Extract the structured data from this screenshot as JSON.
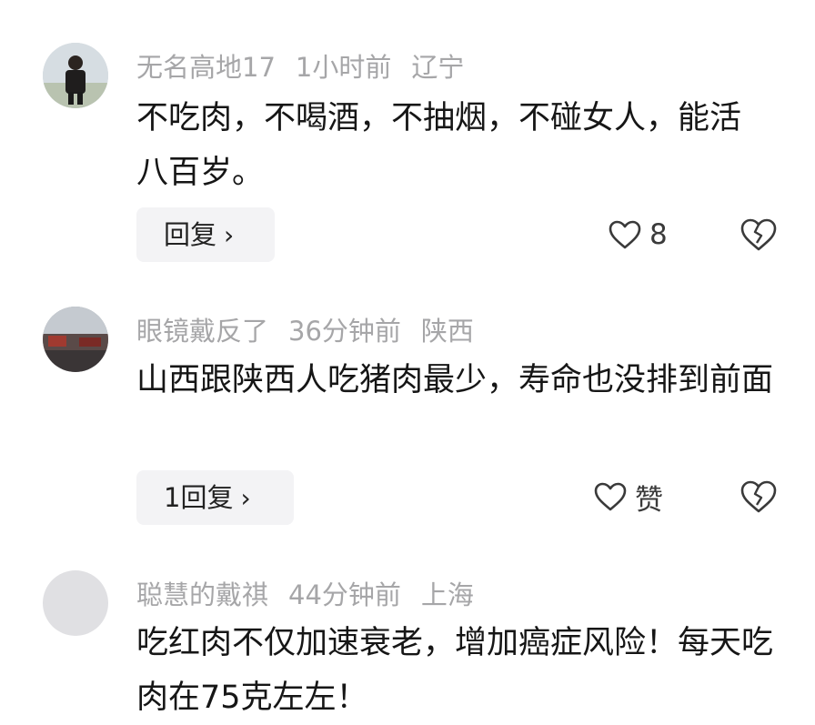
{
  "comments": [
    {
      "username": "无名高地17",
      "time": "1小时前",
      "location": "辽宁",
      "text": "不吃肉，不喝酒，不抽烟，不碰女人，能活八百岁。",
      "reply_label": "回复",
      "like_label": "8"
    },
    {
      "username": "眼镜戴反了",
      "time": "36分钟前",
      "location": "陕西",
      "text": "山西跟陕西人吃猪肉最少，寿命也没排到前面",
      "reply_label": "1回复",
      "like_label": "赞"
    },
    {
      "username": "聪慧的戴祺",
      "time": "44分钟前",
      "location": "上海",
      "text": "吃红肉不仅加速衰老，增加癌症风险！每天吃肉在75克左左！"
    }
  ],
  "icons": {
    "reply_chevron": "chevron-right-icon",
    "like": "heart-outline-icon",
    "dislike": "broken-heart-icon"
  },
  "colors": {
    "meta_text": "#a6a6a8",
    "body_text": "#161616",
    "reply_bg": "#f3f3f5"
  }
}
